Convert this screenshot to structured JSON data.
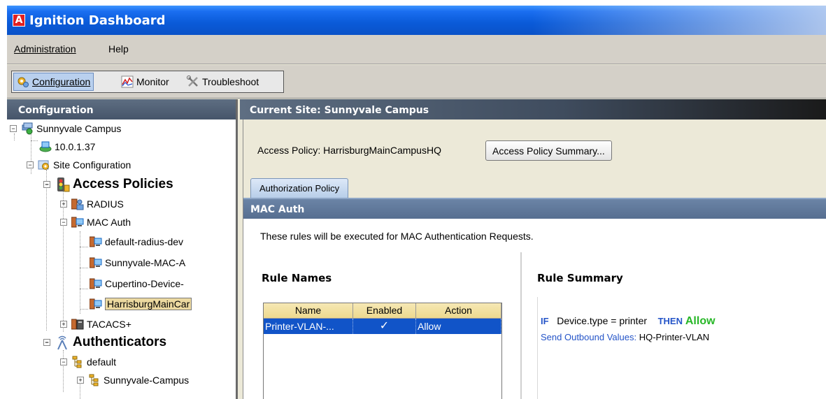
{
  "app": {
    "icon_letter": "A",
    "title": "Ignition Dashboard"
  },
  "menu": {
    "administration": "Administration",
    "help": "Help"
  },
  "toolbar": {
    "configuration": "Configuration",
    "monitor": "Monitor",
    "troubleshoot": "Troubleshoot",
    "icons": [
      "configuration-icon",
      "monitor-chart-icon",
      "troubleshoot-tools-icon"
    ]
  },
  "left": {
    "header": "Configuration",
    "tree": {
      "site": "Sunnyvale Campus",
      "ip": "10.0.1.37",
      "site_config": "Site Configuration",
      "access_policies": "Access Policies",
      "radius": "RADIUS",
      "mac_auth": "MAC Auth",
      "mac_children": [
        "default-radius-dev",
        "Sunnyvale-MAC-A",
        "Cupertino-Device-",
        "HarrisburgMainCar"
      ],
      "tacacs": "TACACS+",
      "authenticators": "Authenticators",
      "default": "default",
      "sunnyvale_campus_auth": "Sunnyvale-Campus"
    }
  },
  "right": {
    "site_header": "Current Site:  Sunnyvale Campus",
    "access_policy_label": "Access Policy:  HarrisburgMainCampusHQ",
    "summary_button": "Access Policy Summary...",
    "tab": "Authorization Policy",
    "mac_header": "MAC Auth",
    "description": "These rules will be executed for MAC Authentication Requests.",
    "rule_names_title": "Rule Names",
    "rule_summary_title": "Rule Summary",
    "table": {
      "headers": [
        "Name",
        "Enabled",
        "Action"
      ],
      "rows": [
        {
          "name": "Printer-VLAN-...",
          "enabled": "✓",
          "action": "Allow"
        }
      ]
    },
    "summary": {
      "if": "IF",
      "condition": "Device.type = printer",
      "then": "THEN",
      "action": "Allow",
      "send_label": "Send Outbound Values:",
      "send_value": "HQ-Printer-VLAN"
    }
  },
  "colors": {
    "title_bar": "#0a5ad8",
    "allow_green": "#27b727",
    "keyword_blue": "#2454c8",
    "selected_row": "#1154c8"
  }
}
